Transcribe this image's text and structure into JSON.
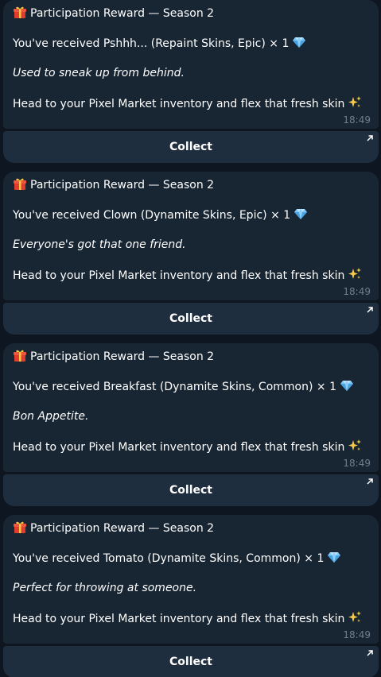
{
  "messages": [
    {
      "title": "Participation Reward — Season 2",
      "received": "You've received Pshhh... (Repaint Skins, Epic) × 1",
      "flavor": "Used to sneak up from behind.",
      "cta": "Head to your Pixel Market inventory and flex that fresh skin",
      "time": "18:49",
      "button_label": "Collect"
    },
    {
      "title": "Participation Reward — Season 2",
      "received": "You've received Clown (Dynamite Skins, Epic) × 1",
      "flavor": "Everyone's got that one friend.",
      "cta": "Head to your Pixel Market inventory and flex that fresh skin",
      "time": "18:49",
      "button_label": "Collect"
    },
    {
      "title": "Participation Reward — Season 2",
      "received": "You've received Breakfast (Dynamite Skins, Common) × 1",
      "flavor": "Bon Appetite.",
      "cta": "Head to your Pixel Market inventory and flex that fresh skin",
      "time": "18:49",
      "button_label": "Collect"
    },
    {
      "title": "Participation Reward — Season 2",
      "received": "You've received Tomato (Dynamite Skins, Common) × 1",
      "flavor": "Perfect for throwing at someone.",
      "cta": "Head to your Pixel Market inventory and flex that fresh skin",
      "time": "18:49",
      "button_label": "Collect"
    }
  ],
  "icons": {
    "title": "gift-icon",
    "received": "gem-icon",
    "cta": "sparkles-icon",
    "button": "external-link-arrow-icon"
  },
  "colors": {
    "background": "#0e1621",
    "bubble": "#182533",
    "button": "#1f2e3e",
    "timestamp": "#6d7f8f"
  }
}
